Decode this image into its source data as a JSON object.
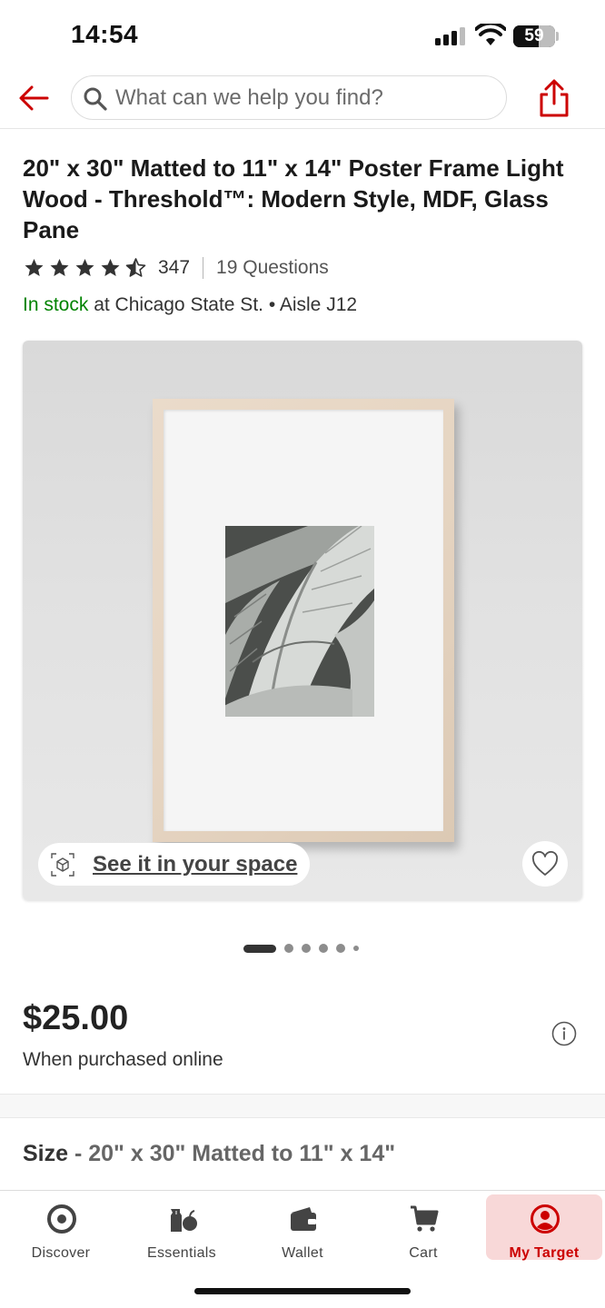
{
  "status_bar": {
    "time": "14:54",
    "battery": "59"
  },
  "search": {
    "placeholder": "What can we help you find?"
  },
  "product": {
    "title": "20\" x 30\" Matted to 11\" x 14\" Poster Frame Light Wood - Threshold™: Modern Style, MDF, Glass Pane",
    "rating": 4.5,
    "review_count": "347",
    "questions": "19 Questions",
    "stock_status": "In stock",
    "stock_location": " at Chicago State St. • Aisle J12",
    "see_in_space": "See it in your space",
    "price": "$25.00",
    "price_note": "When purchased online",
    "size_label": "Size",
    "size_value": " - 20\" x 30\" Matted to 11\" x 14\""
  },
  "carousel": {
    "count": 6,
    "active_index": 0
  },
  "tabs": [
    {
      "label": "Discover",
      "icon": "target-icon"
    },
    {
      "label": "Essentials",
      "icon": "essentials-icon"
    },
    {
      "label": "Wallet",
      "icon": "wallet-icon"
    },
    {
      "label": "Cart",
      "icon": "cart-icon"
    },
    {
      "label": "My Target",
      "icon": "account-icon",
      "active": true
    }
  ],
  "colors": {
    "brand_red": "#cc0000",
    "in_stock_green": "#008300",
    "active_tab_bg": "#f8d8d8"
  }
}
